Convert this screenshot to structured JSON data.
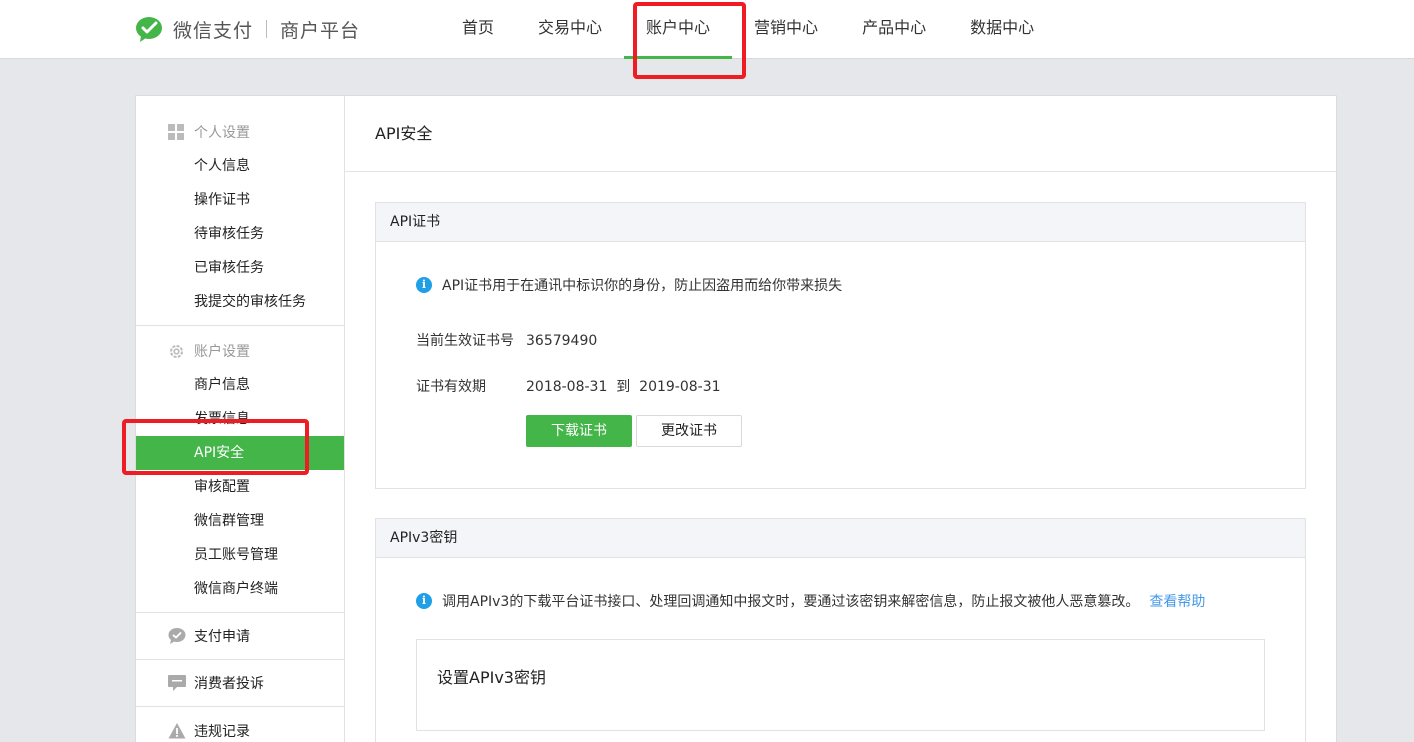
{
  "header": {
    "brand": "微信支付",
    "subtitle": "商户平台",
    "nav": [
      "首页",
      "交易中心",
      "账户中心",
      "营销中心",
      "产品中心",
      "数据中心"
    ],
    "active_nav": "账户中心"
  },
  "sidebar": {
    "personal": {
      "title": "个人设置",
      "items": [
        "个人信息",
        "操作证书",
        "待审核任务",
        "已审核任务",
        "我提交的审核任务"
      ]
    },
    "account": {
      "title": "账户设置",
      "items": [
        "商户信息",
        "发票信息",
        "API安全",
        "审核配置",
        "微信群管理",
        "员工账号管理",
        "微信商户终端"
      ]
    },
    "active_item": "API安全",
    "pay_apply": "支付申请",
    "complaints": "消费者投诉",
    "violations": "违规记录"
  },
  "content": {
    "title": "API安全",
    "cert_card": {
      "title": "API证书",
      "tip": "API证书用于在通讯中标识你的身份，防止因盗用而给你带来损失",
      "current_label": "当前生效证书号",
      "current_value": "36579490",
      "validity_label": "证书有效期",
      "validity_value": "2018-08-31  到  2019-08-31",
      "download_button": "下载证书",
      "change_button": "更改证书"
    },
    "apiv3_card": {
      "title": "APIv3密钥",
      "tip": "调用APIv3的下载平台证书接口、处理回调通知中报文时，要通过该密钥来解密信息，防止报文被他人恶意篡改。",
      "help_link": "查看帮助",
      "set_key_label": "设置APIv3密钥"
    }
  },
  "colors": {
    "brand_green": "#44b549",
    "highlight_red": "#ee1d23",
    "info_blue": "#1e9fe6",
    "link_blue": "#459ae9"
  }
}
